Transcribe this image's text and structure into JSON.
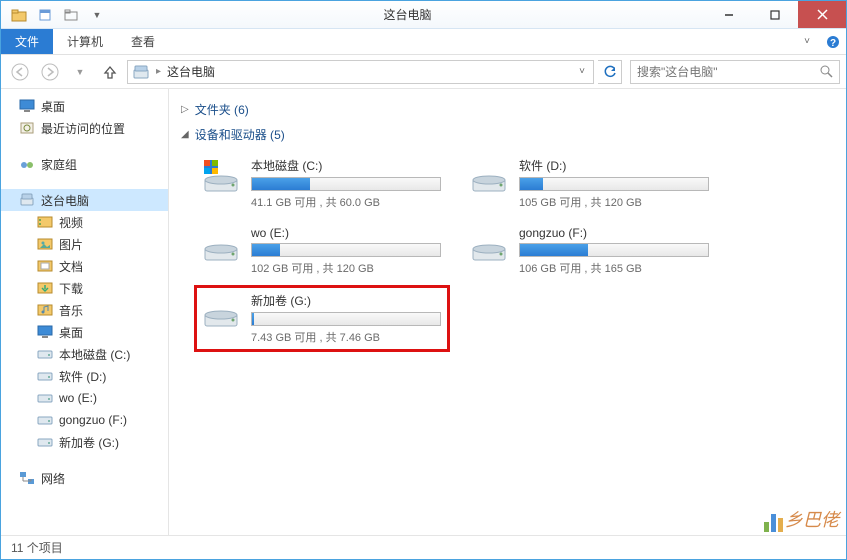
{
  "window": {
    "title": "这台电脑"
  },
  "ribbon": {
    "file": "文件",
    "tabs": [
      "计算机",
      "查看"
    ]
  },
  "nav": {
    "breadcrumb": "这台电脑",
    "search_placeholder": "搜索\"这台电脑\""
  },
  "tree": {
    "quick": [
      {
        "icon": "desktop",
        "label": "桌面"
      },
      {
        "icon": "recent",
        "label": "最近访问的位置"
      }
    ],
    "homegroup": {
      "label": "家庭组"
    },
    "thispc": {
      "label": "这台电脑",
      "children": [
        {
          "icon": "video",
          "label": "视频"
        },
        {
          "icon": "picture",
          "label": "图片"
        },
        {
          "icon": "document",
          "label": "文档"
        },
        {
          "icon": "download",
          "label": "下载"
        },
        {
          "icon": "music",
          "label": "音乐"
        },
        {
          "icon": "desktop",
          "label": "桌面"
        },
        {
          "icon": "drive",
          "label": "本地磁盘 (C:)"
        },
        {
          "icon": "drive",
          "label": "软件 (D:)"
        },
        {
          "icon": "drive",
          "label": "wo (E:)"
        },
        {
          "icon": "drive",
          "label": "gongzuo (F:)"
        },
        {
          "icon": "drive",
          "label": "新加卷 (G:)"
        }
      ]
    },
    "network": {
      "label": "网络"
    }
  },
  "sections": {
    "folders": {
      "title": "文件夹",
      "count": 6
    },
    "devices": {
      "title": "设备和驱动器",
      "count": 5
    }
  },
  "drives": [
    {
      "name": "本地磁盘 (C:)",
      "free": "41.1 GB",
      "total": "60.0 GB",
      "used_pct": 31,
      "system": true
    },
    {
      "name": "软件 (D:)",
      "free": "105 GB",
      "total": "120 GB",
      "used_pct": 12
    },
    {
      "name": "wo (E:)",
      "free": "102 GB",
      "total": "120 GB",
      "used_pct": 15
    },
    {
      "name": "gongzuo (F:)",
      "free": "106 GB",
      "total": "165 GB",
      "used_pct": 36
    },
    {
      "name": "新加卷 (G:)",
      "free": "7.43 GB",
      "total": "7.46 GB",
      "used_pct": 1,
      "highlight": true
    }
  ],
  "storage_text": {
    "free": "可用",
    "sep": "，共"
  },
  "status": {
    "items": "11 个项目"
  },
  "watermark": "乡巴佬"
}
